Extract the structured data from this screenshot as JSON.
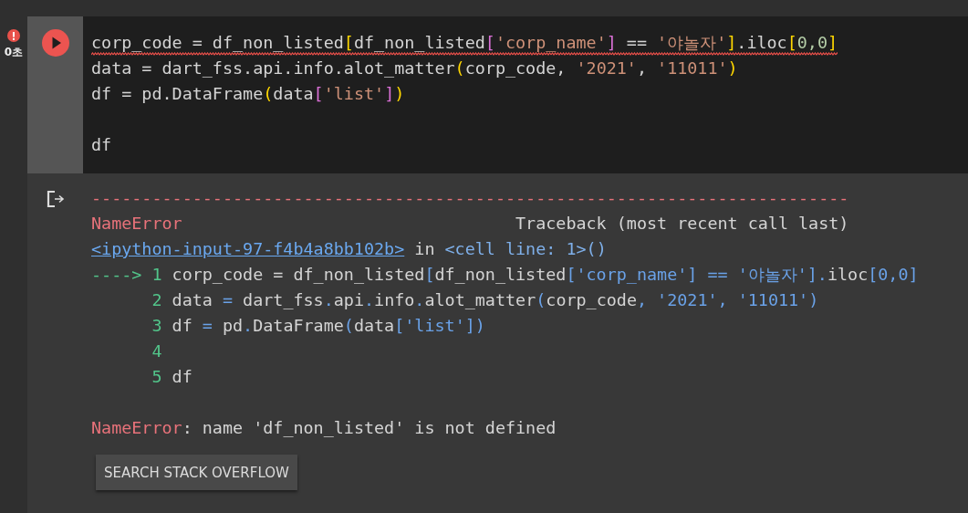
{
  "cell": {
    "status": {
      "error": true,
      "duration": "0초"
    },
    "code_lines": [
      {
        "kind": "code",
        "error_underline": true,
        "tokens": [
          {
            "kind": "plain",
            "text": "corp_code = df_non_listed"
          },
          {
            "kind": "bracket",
            "text": "["
          },
          {
            "kind": "plain",
            "text": "df_non_listed"
          },
          {
            "kind": "bracket2",
            "text": "["
          },
          {
            "kind": "string",
            "text": "'corp_name'"
          },
          {
            "kind": "bracket2",
            "text": "]"
          },
          {
            "kind": "plain",
            "text": " == "
          },
          {
            "kind": "string",
            "text": "'야놀자'"
          },
          {
            "kind": "bracket",
            "text": "]"
          },
          {
            "kind": "plain",
            "text": ".iloc"
          },
          {
            "kind": "bracket",
            "text": "["
          },
          {
            "kind": "number",
            "text": "0,0"
          },
          {
            "kind": "bracket",
            "text": "]"
          }
        ]
      },
      {
        "kind": "code",
        "error_underline": false,
        "tokens": [
          {
            "kind": "plain",
            "text": "data = dart_fss.api.info.alot_matter"
          },
          {
            "kind": "bracket",
            "text": "("
          },
          {
            "kind": "plain",
            "text": "corp_code, "
          },
          {
            "kind": "string",
            "text": "'2021'"
          },
          {
            "kind": "plain",
            "text": ", "
          },
          {
            "kind": "string",
            "text": "'11011'"
          },
          {
            "kind": "bracket",
            "text": ")"
          }
        ]
      },
      {
        "kind": "code",
        "error_underline": false,
        "tokens": [
          {
            "kind": "plain",
            "text": "df = pd.DataFrame"
          },
          {
            "kind": "bracket",
            "text": "("
          },
          {
            "kind": "plain",
            "text": "data"
          },
          {
            "kind": "bracket2",
            "text": "["
          },
          {
            "kind": "string",
            "text": "'list'"
          },
          {
            "kind": "bracket2",
            "text": "]"
          },
          {
            "kind": "bracket",
            "text": ")"
          }
        ]
      },
      {
        "kind": "blank"
      },
      {
        "kind": "code",
        "error_underline": false,
        "tokens": [
          {
            "kind": "plain",
            "text": "df"
          }
        ]
      }
    ]
  },
  "output": {
    "rule": "---------------------------------------------------------------------------",
    "error_name": "NameError",
    "traceback_label": "Traceback (most recent call last)",
    "location": {
      "link": "<ipython-input-97-f4b4a8bb102b>",
      "in": " in ",
      "where": "<cell line: 1>()"
    },
    "frames": [
      {
        "arrow": "---->",
        "number": "1",
        "tokens": [
          {
            "kind": "plain",
            "text": "corp_code = df_non_listed"
          },
          {
            "kind": "accent",
            "text": "["
          },
          {
            "kind": "plain",
            "text": "df_non_listed"
          },
          {
            "kind": "accent",
            "text": "['corp_name'] == '야놀자']."
          },
          {
            "kind": "plain",
            "text": "iloc"
          },
          {
            "kind": "accent",
            "text": "[0,0]"
          }
        ]
      },
      {
        "number": "2",
        "tokens": [
          {
            "kind": "plain",
            "text": "data "
          },
          {
            "kind": "accent",
            "text": "="
          },
          {
            "kind": "plain",
            "text": " dart_fss"
          },
          {
            "kind": "accent",
            "text": "."
          },
          {
            "kind": "plain",
            "text": "api"
          },
          {
            "kind": "accent",
            "text": "."
          },
          {
            "kind": "plain",
            "text": "info"
          },
          {
            "kind": "accent",
            "text": "."
          },
          {
            "kind": "plain",
            "text": "alot_matter"
          },
          {
            "kind": "accent",
            "text": "("
          },
          {
            "kind": "plain",
            "text": "corp_code"
          },
          {
            "kind": "accent",
            "text": ", '2021', '11011')"
          }
        ]
      },
      {
        "number": "3",
        "tokens": [
          {
            "kind": "plain",
            "text": "df "
          },
          {
            "kind": "accent",
            "text": "="
          },
          {
            "kind": "plain",
            "text": " pd"
          },
          {
            "kind": "accent",
            "text": "."
          },
          {
            "kind": "plain",
            "text": "DataFrame"
          },
          {
            "kind": "accent",
            "text": "("
          },
          {
            "kind": "plain",
            "text": "data"
          },
          {
            "kind": "accent",
            "text": "['list'])"
          }
        ]
      },
      {
        "number": "4"
      },
      {
        "number": "5",
        "tokens": [
          {
            "kind": "plain",
            "text": "df"
          }
        ]
      }
    ],
    "message": {
      "error_name": "NameError",
      "text": ": name 'df_non_listed' is not defined"
    },
    "button": "SEARCH STACK OVERFLOW"
  }
}
